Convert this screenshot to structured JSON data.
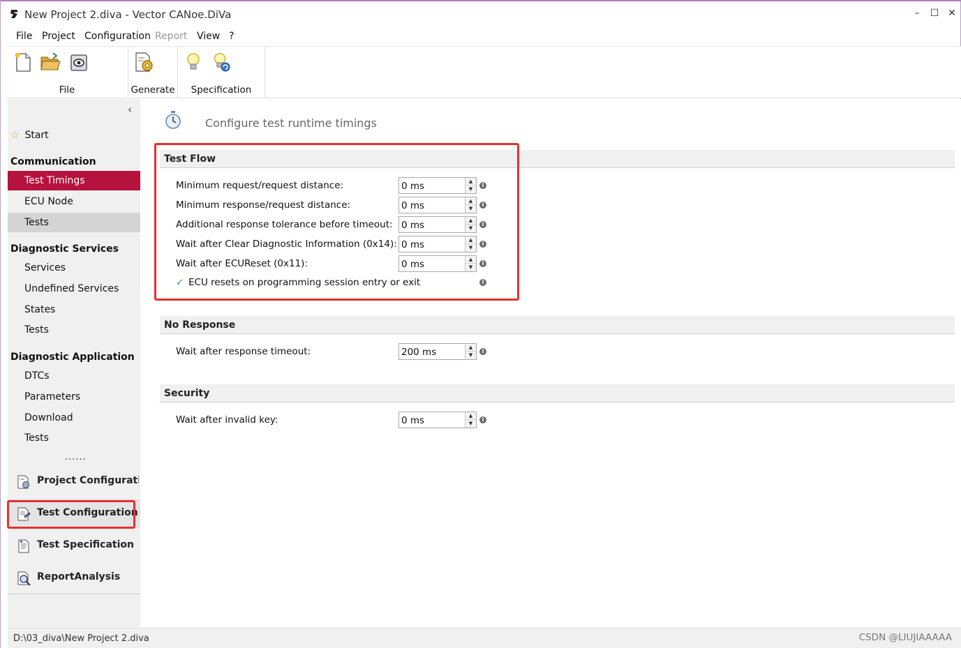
{
  "window": {
    "title": "New Project 2.diva - Vector CANoe.DiVa",
    "minimize": "–",
    "maximize": "☐",
    "close": "✕"
  },
  "menu": [
    "File",
    "Project",
    "Configuration",
    "Report",
    "View",
    "?"
  ],
  "ribbon": {
    "groups": [
      {
        "label": "File",
        "icons": [
          "new-project-icon",
          "open-folder-icon",
          "save-project-icon"
        ]
      },
      {
        "label": "Generate",
        "icons": [
          "generate-gear-icon"
        ]
      },
      {
        "label": "Specification",
        "icons": [
          "lightbulb-icon",
          "lightbulb-refresh-icon"
        ]
      }
    ]
  },
  "sidebar": {
    "collapse": "‹",
    "start": "Start",
    "communication": {
      "header": "Communication",
      "items": [
        "Test Timings",
        "ECU Node",
        "Tests"
      ]
    },
    "diagnostic_services": {
      "header": "Diagnostic Services",
      "items": [
        "Services",
        "Undefined Services",
        "States",
        "Tests"
      ]
    },
    "diagnostic_application": {
      "header": "Diagnostic Application",
      "items": [
        "DTCs",
        "Parameters",
        "Download",
        "Tests"
      ]
    },
    "more": "......",
    "bottom": [
      "Project Configuration",
      "Test Configuration",
      "Test Specification",
      "ReportAnalysis"
    ]
  },
  "main": {
    "title": "Configure test runtime timings",
    "test_flow": {
      "header": "Test Flow",
      "rows": [
        {
          "label": "Minimum request/request distance:",
          "value": "0 ms"
        },
        {
          "label": "Minimum response/request distance:",
          "value": "0 ms"
        },
        {
          "label": "Additional response tolerance before timeout:",
          "value": "0 ms"
        },
        {
          "label": "Wait after Clear Diagnostic Information (0x14):",
          "value": "0 ms"
        },
        {
          "label": "Wait after ECUReset (0x11):",
          "value": "0 ms"
        }
      ],
      "checkbox": "ECU resets on programming session entry or exit"
    },
    "no_response": {
      "header": "No Response",
      "rows": [
        {
          "label": "Wait after response timeout:",
          "value": "200 ms"
        }
      ]
    },
    "security": {
      "header": "Security",
      "rows": [
        {
          "label": "Wait after invalid key:",
          "value": "0 ms"
        }
      ]
    }
  },
  "status": {
    "path": "D:\\03_diva\\New Project 2.diva",
    "watermark": "CSDN @LIUJIAAAAA"
  },
  "colors": {
    "active_item": "#b5123d",
    "highlight_box": "#e53030"
  }
}
